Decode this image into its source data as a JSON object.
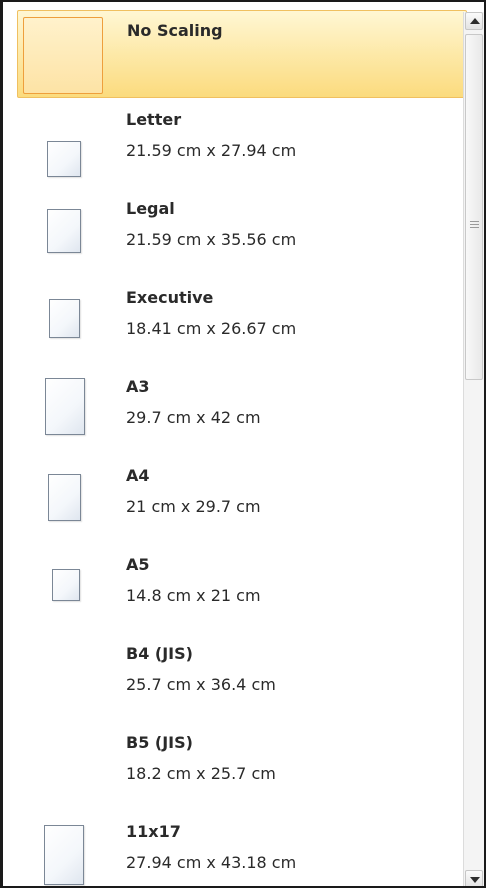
{
  "paper_sizes": [
    {
      "label": "No Scaling",
      "dims": "",
      "selected": true,
      "thumb": "none"
    },
    {
      "label": "Letter",
      "dims": "21.59 cm x 27.94 cm",
      "selected": false,
      "thumb": "page"
    },
    {
      "label": "Legal",
      "dims": "21.59 cm x 35.56 cm",
      "selected": false,
      "thumb": "page"
    },
    {
      "label": "Executive",
      "dims": "18.41 cm x 26.67 cm",
      "selected": false,
      "thumb": "page"
    },
    {
      "label": "A3",
      "dims": "29.7 cm x 42 cm",
      "selected": false,
      "thumb": "page"
    },
    {
      "label": "A4",
      "dims": "21 cm x 29.7 cm",
      "selected": false,
      "thumb": "page"
    },
    {
      "label": "A5",
      "dims": "14.8 cm x 21 cm",
      "selected": false,
      "thumb": "page"
    },
    {
      "label": "B4 (JIS)",
      "dims": "25.7 cm x 36.4 cm",
      "selected": false,
      "thumb": "none"
    },
    {
      "label": "B5 (JIS)",
      "dims": "18.2 cm x 25.7 cm",
      "selected": false,
      "thumb": "none"
    },
    {
      "label": "11x17",
      "dims": "27.94 cm x 43.18 cm",
      "selected": false,
      "thumb": "page"
    }
  ],
  "scrollbar": {
    "up_icon": "arrow-up",
    "down_icon": "arrow-down",
    "grip_icon": "grip-lines"
  },
  "colors": {
    "selected_bg": "#fde9a8",
    "selected_border": "#f0c060",
    "thumb_border": "#7b8796",
    "text": "#2a2a2a"
  }
}
